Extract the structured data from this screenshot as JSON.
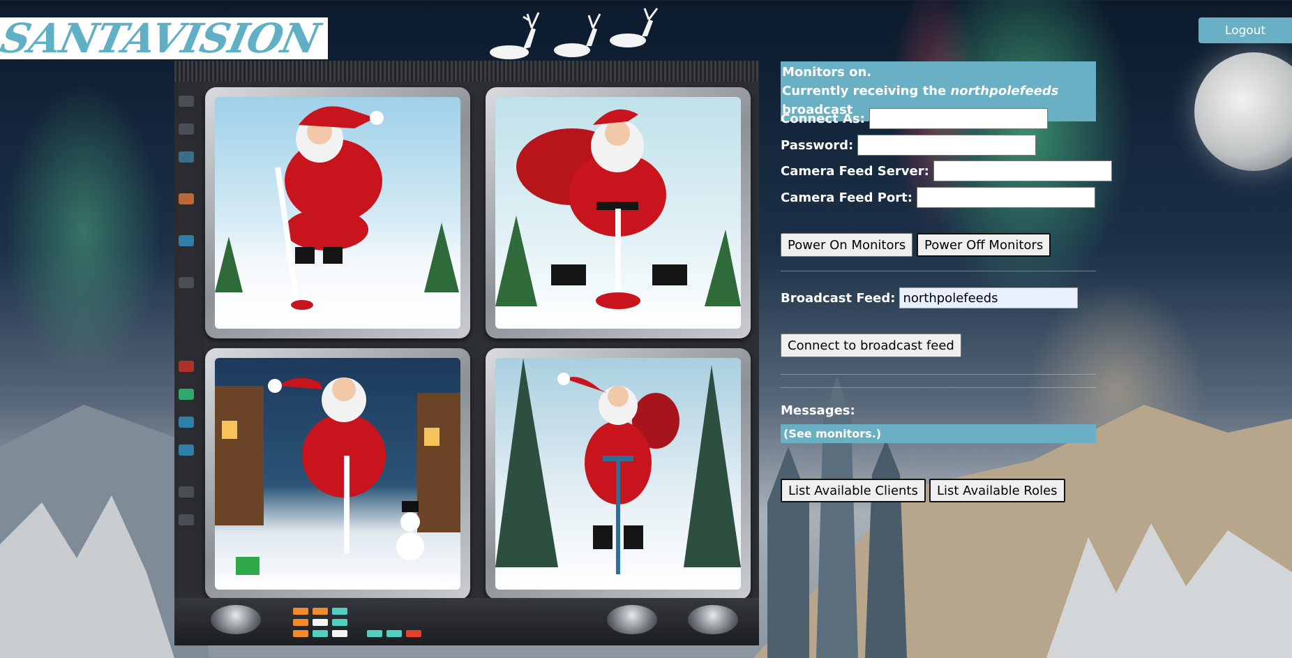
{
  "header": {
    "logo_text": "SANTAVISION",
    "logout_label": "Logout"
  },
  "status": {
    "line1": "Monitors on.",
    "line2_prefix": "Currently receiving the ",
    "line2_feed": "northpolefeeds",
    "line2_suffix": " broadcast"
  },
  "form": {
    "connect_as_label": "Connect As:",
    "connect_as_value": "",
    "password_label": "Password:",
    "password_value": "",
    "server_label": "Camera Feed Server:",
    "server_value": "",
    "port_label": "Camera Feed Port:",
    "port_value": ""
  },
  "monitor_controls": {
    "power_on_label": "Power On Monitors",
    "power_off_label": "Power Off Monitors"
  },
  "broadcast": {
    "label": "Broadcast Feed:",
    "value": "northpolefeeds",
    "connect_label": "Connect to broadcast feed"
  },
  "messages": {
    "label": "Messages:",
    "text": "(See monitors.)"
  },
  "lists": {
    "clients_label": "List Available Clients",
    "roles_label": "List Available Roles"
  },
  "colors": {
    "accent": "#6ab0c4",
    "button_bg": "#efefef"
  }
}
